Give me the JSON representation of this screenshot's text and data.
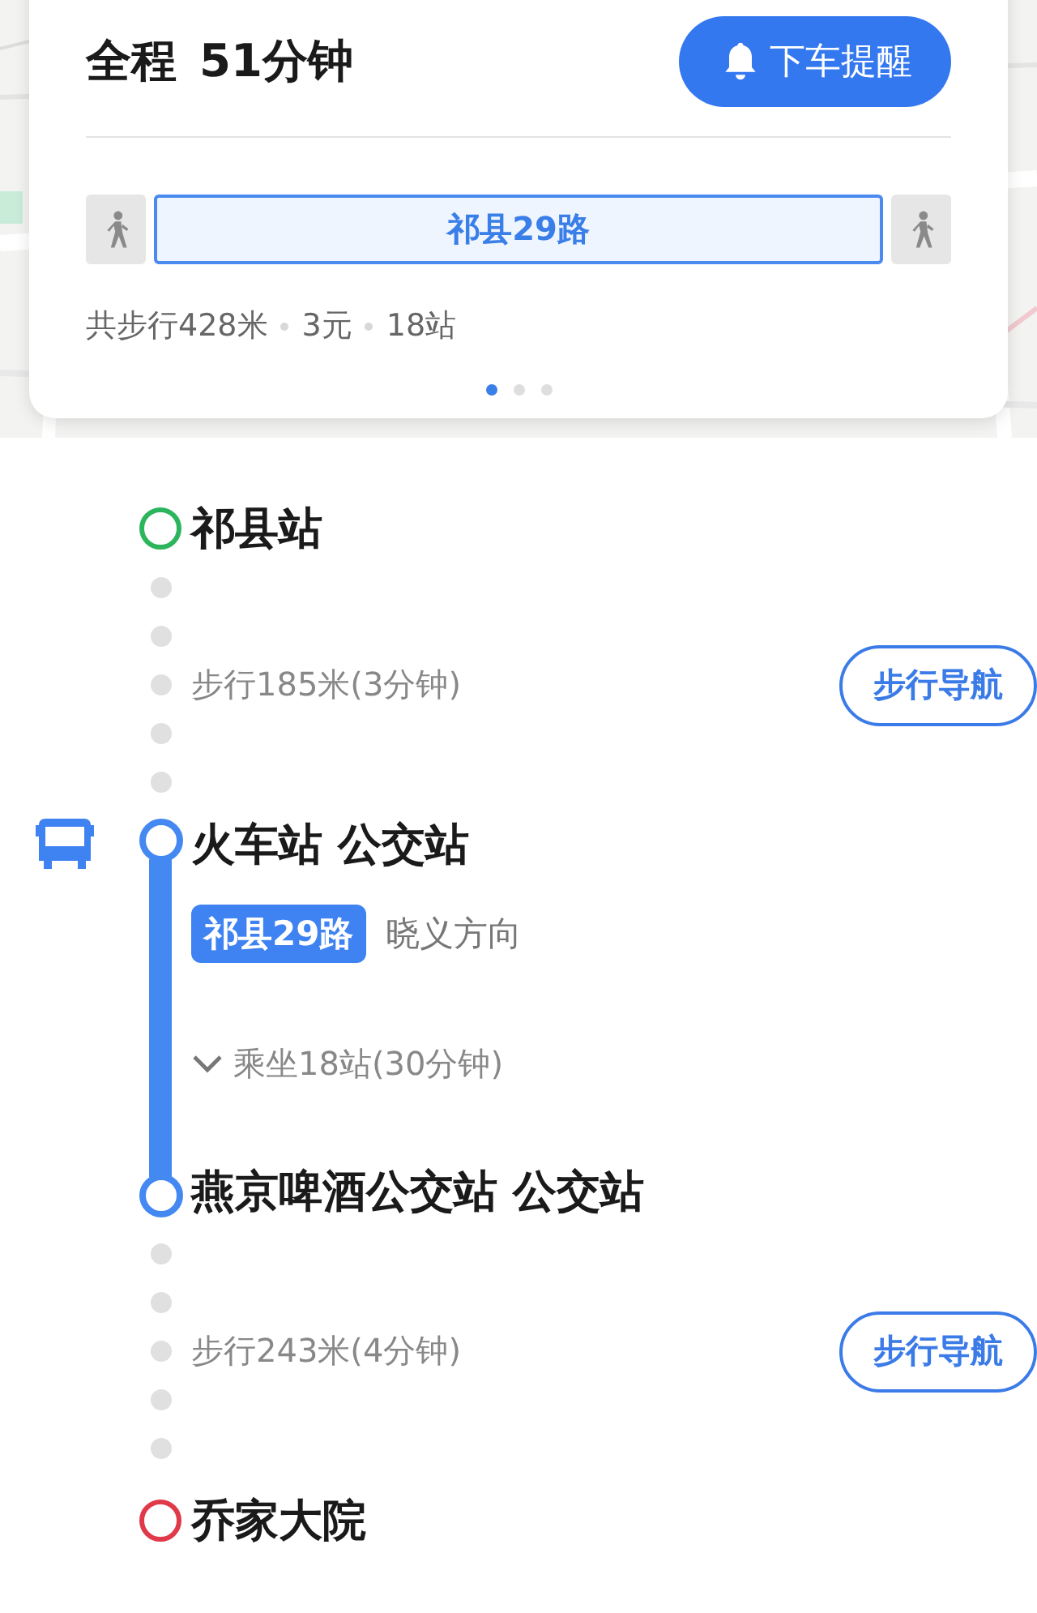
{
  "summary": {
    "title": "全程",
    "duration": "51分钟",
    "alert_button": "下车提醒",
    "segments": [
      {
        "kind": "walk"
      },
      {
        "kind": "bus",
        "label": "祁县29路"
      },
      {
        "kind": "walk"
      }
    ],
    "stats": [
      "共步行428米",
      "3元",
      "18站"
    ],
    "pages": [
      {
        "selected": true
      },
      {
        "selected": false
      },
      {
        "selected": false
      }
    ]
  },
  "timeline": [
    {
      "kind": "station",
      "name": "祁县站",
      "color": "#2db55d"
    },
    {
      "kind": "walk",
      "text": "步行185米(3分钟)",
      "button": "步行导航"
    },
    {
      "kind": "bus",
      "board": "火车站 公交站",
      "line": "祁县29路",
      "direction": "晓义方向",
      "ride": "乘坐18站(30分钟)",
      "expanded": false,
      "alight": "燕京啤酒公交站 公交站"
    },
    {
      "kind": "walk",
      "text": "步行243米(4分钟)",
      "button": "步行导航"
    },
    {
      "kind": "station",
      "name": "乔家大院",
      "color": "#e0394a"
    }
  ]
}
